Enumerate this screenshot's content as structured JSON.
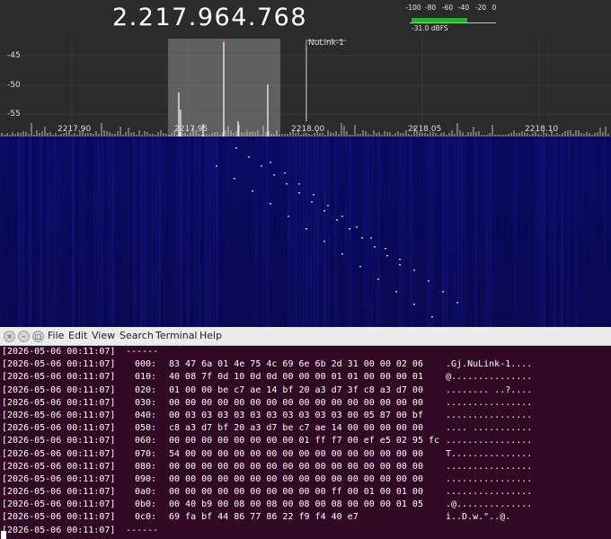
{
  "sdr": {
    "frequency": "2.217.964.768",
    "meter": {
      "ticks": [
        "-100",
        "-80",
        "-60",
        "-40",
        "-20",
        "0"
      ],
      "level_dbfs": -31.0,
      "label": "-31.0 dBFS"
    },
    "y_labels": [
      "-45",
      "-50",
      "-55"
    ],
    "x_labels": [
      "2217.90",
      "2217.95",
      "2218.00",
      "2218.05",
      "2218.10"
    ],
    "marker_label": "NuLink-1",
    "colors": {
      "background": "#2b2b2b",
      "waterfall": "#0a0a5c",
      "signal": "#e85050"
    }
  },
  "terminal": {
    "menu": [
      "File",
      "Edit",
      "View",
      "Search",
      "Terminal",
      "Help"
    ],
    "window_buttons": [
      "close-icon",
      "minimize-icon",
      "maximize-icon"
    ],
    "lines": [
      {
        "ts": "[2026-05-06 00:11:07]",
        "off": "------",
        "hex": "",
        "asc": ""
      },
      {
        "ts": "[2026-05-06 00:11:07]",
        "off": "000:",
        "hex": "83 47 6a 01 4e 75 4c 69 6e 6b 2d 31 00 00 02 06",
        "asc": ".Gj.NuLink-1...."
      },
      {
        "ts": "[2026-05-06 00:11:07]",
        "off": "010:",
        "hex": "40 08 7f 0d 10 0d 0d 00 00 00 01 01 00 00 00 01",
        "asc": "@..............."
      },
      {
        "ts": "[2026-05-06 00:11:07]",
        "off": "020:",
        "hex": "01 00 00 be c7 ae 14 bf 20 a3 d7 3f c8 a3 d7 00",
        "asc": "........ ..?...."
      },
      {
        "ts": "[2026-05-06 00:11:07]",
        "off": "030:",
        "hex": "00 00 00 00 00 00 00 00 00 00 00 00 00 00 00 00",
        "asc": "................"
      },
      {
        "ts": "[2026-05-06 00:11:07]",
        "off": "040:",
        "hex": "00 03 03 03 03 03 03 03 03 03 03 00 05 87 00 bf",
        "asc": "................"
      },
      {
        "ts": "[2026-05-06 00:11:07]",
        "off": "050:",
        "hex": "c8 a3 d7 bf 20 a3 d7 be c7 ae 14 00 00 00 00 00",
        "asc": ".... ..........."
      },
      {
        "ts": "[2026-05-06 00:11:07]",
        "off": "060:",
        "hex": "00 00 00 00 00 00 00 00 01 ff f7 00 ef e5 02 95 fc",
        "asc": "................"
      },
      {
        "ts": "[2026-05-06 00:11:07]",
        "off": "070:",
        "hex": "54 00 00 00 00 00 00 00 00 00 00 00 00 00 00 00",
        "asc": "T..............."
      },
      {
        "ts": "[2026-05-06 00:11:07]",
        "off": "080:",
        "hex": "00 00 00 00 00 00 00 00 00 00 00 00 00 00 00 00",
        "asc": "................"
      },
      {
        "ts": "[2026-05-06 00:11:07]",
        "off": "090:",
        "hex": "00 00 00 00 00 00 00 00 00 00 00 00 00 00 00 00",
        "asc": "................"
      },
      {
        "ts": "[2026-05-06 00:11:07]",
        "off": "0a0:",
        "hex": "00 00 00 00 00 00 00 00 00 00 ff 00 01 00 01 00",
        "asc": "................"
      },
      {
        "ts": "[2026-05-06 00:11:07]",
        "off": "0b0:",
        "hex": "00 40 b9 00 08 00 08 00 08 00 08 00 00 00 01 05",
        "asc": ".@.............."
      },
      {
        "ts": "[2026-05-06 00:11:07]",
        "off": "0c0:",
        "hex": "69 fa bf 44 86 77 86 22 f9 f4 40 e7",
        "asc": "i..D.w.\"..@."
      },
      {
        "ts": "[2026-05-06 00:11:07]",
        "off": "------",
        "hex": "",
        "asc": ""
      }
    ]
  }
}
